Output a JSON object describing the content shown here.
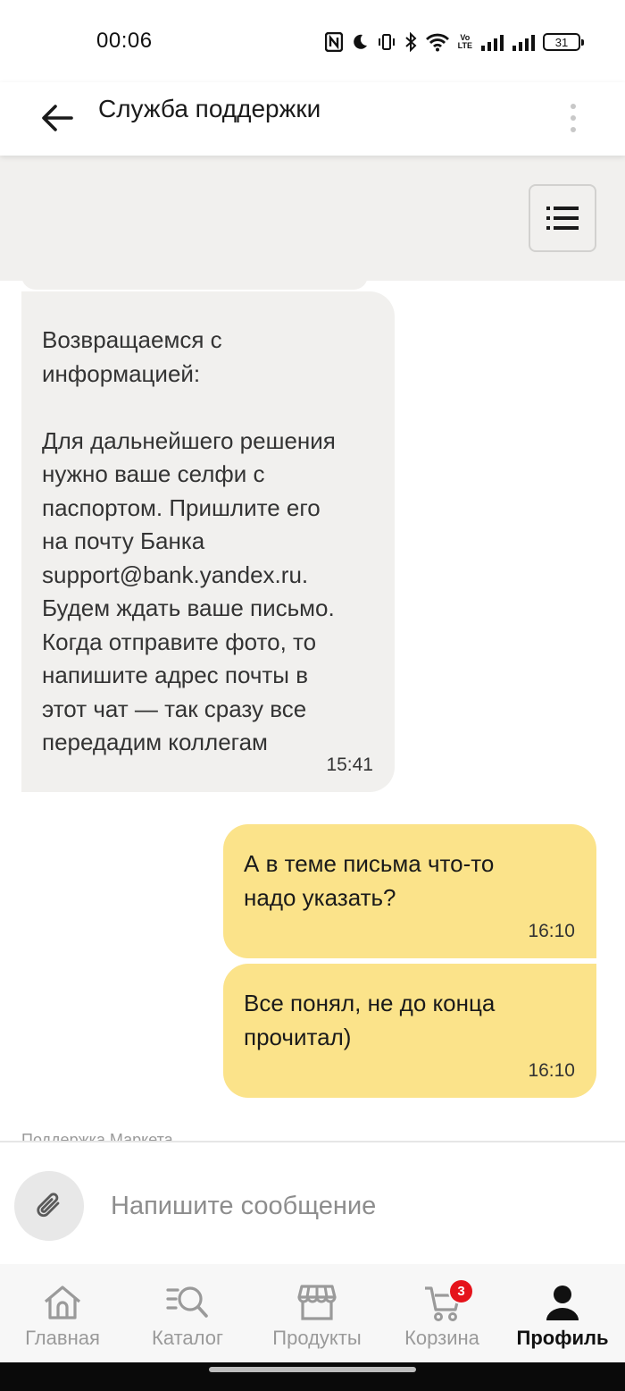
{
  "status_bar": {
    "time": "00:06",
    "battery": "31",
    "icons": [
      "nfc-icon",
      "moon-icon",
      "vibrate-icon",
      "bluetooth-icon",
      "wifi-icon",
      "volte-icon",
      "signal-icon",
      "signal-icon",
      "battery-icon"
    ],
    "volte_top": "Vo",
    "volte_bottom": "LTE"
  },
  "header": {
    "title": "Служба поддержки",
    "back_icon": "arrow-left-icon",
    "more_icon": "more-vertical-icon"
  },
  "quick_menu": {
    "icon": "list-menu-icon"
  },
  "messages": [
    {
      "direction": "incoming",
      "text": "Возвращаемся с\nинформацией:\n\nДля дальнейшего решения\nнужно ваше селфи с\nпаспортом. Пришлите его\nна почту Банка\nsupport@bank.yandex.ru.\nБудем ждать ваше письмо.\nКогда отправите фото, то\nнапишите адрес почты в\nэтот чат — так сразу все\nпередадим коллегам",
      "time": "15:41"
    },
    {
      "direction": "outgoing",
      "text": "А в теме письма что-то\nнадо указать?",
      "time": "16:10"
    },
    {
      "direction": "outgoing",
      "text": "Все понял, не до конца\nпрочитал)",
      "time": "16:10"
    }
  ],
  "sender_peek": "Поддержка Маркета",
  "composer": {
    "placeholder": "Напишите сообщение",
    "value": "",
    "attach_icon": "paperclip-icon"
  },
  "nav": {
    "items": [
      {
        "label": "Главная",
        "icon": "home-icon",
        "active": false
      },
      {
        "label": "Каталог",
        "icon": "catalog-search-icon",
        "active": false
      },
      {
        "label": "Продукты",
        "icon": "store-icon",
        "active": false
      },
      {
        "label": "Корзина",
        "icon": "cart-icon",
        "active": false,
        "badge": "3"
      },
      {
        "label": "Профиль",
        "icon": "profile-icon",
        "active": true
      }
    ]
  },
  "colors": {
    "outgoing_bubble": "#fbe38a",
    "incoming_bubble": "#f1f0ee",
    "badge": "#e5131b",
    "nav_inactive": "#9a9a9a",
    "nav_active": "#111111"
  }
}
